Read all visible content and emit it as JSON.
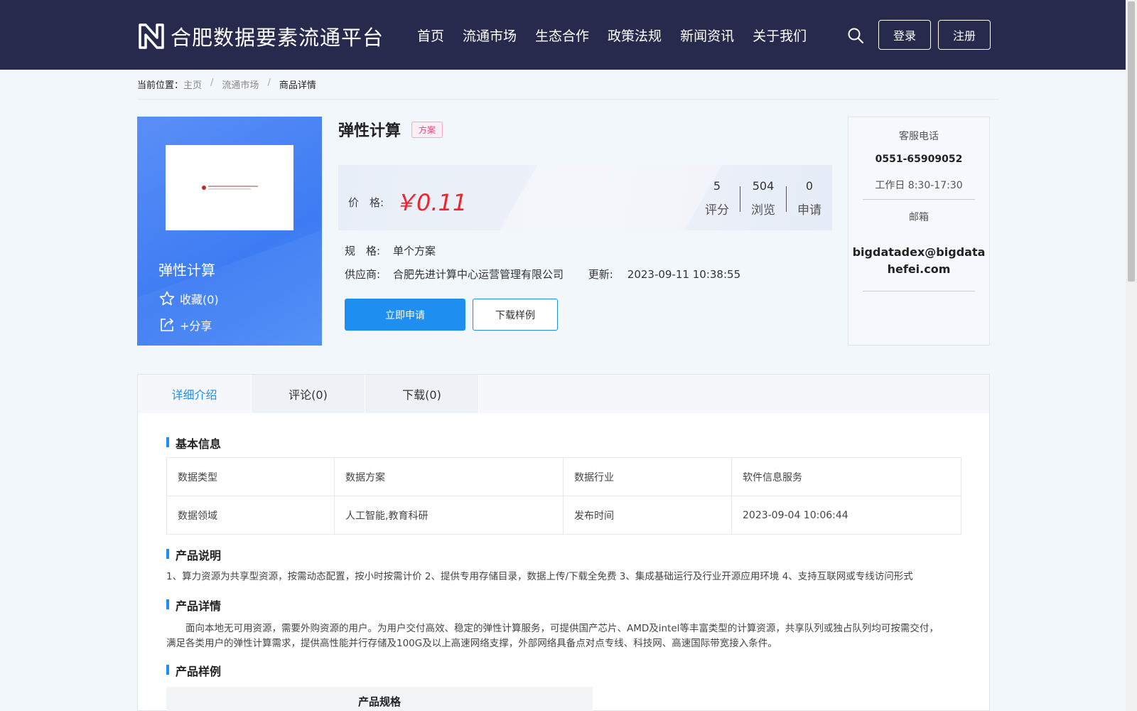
{
  "header": {
    "logo_text": "合肥数据要素流通平台",
    "nav": [
      "首页",
      "流通市场",
      "生态合作",
      "政策法规",
      "新闻资讯",
      "关于我们"
    ],
    "login": "登录",
    "register": "注册"
  },
  "breadcrumb": {
    "prefix": "当前位置：",
    "items": [
      "主页",
      "流通市场",
      "商品详情"
    ]
  },
  "product": {
    "card_name": "弹性计算",
    "favorite": "收藏(0)",
    "share": "+分享",
    "title": "弹性计算",
    "tag": "方案",
    "price_label": "价　格:",
    "price": "￥0.11",
    "stats": [
      {
        "num": "5",
        "label": "评分"
      },
      {
        "num": "504",
        "label": "浏览"
      },
      {
        "num": "0",
        "label": "申请"
      }
    ],
    "spec_label": "规　格:",
    "spec": "单个方案",
    "supplier_label": "供应商:",
    "supplier": "合肥先进计算中心运营管理有限公司",
    "updated_label": "更新:",
    "updated": "2023-09-11 10:38:55",
    "apply": "立即申请",
    "download_sample": "下载样例"
  },
  "service": {
    "phone_title": "客服电话",
    "phone": "0551-65909052",
    "hours": "工作日 8:30-17:30",
    "email_title": "邮箱",
    "email_line1": "bigdatadex@bigdata",
    "email_line2": "hefei.com"
  },
  "tabs": [
    "详细介绍",
    "评论(0)",
    "下载(0)"
  ],
  "detail": {
    "basic_title": "基本信息",
    "basic_rows": [
      [
        "数据类型",
        "数据方案",
        "数据行业",
        "软件信息服务"
      ],
      [
        "数据领域",
        "人工智能,教育科研",
        "发布时间",
        "2023-09-04 10:06:44"
      ]
    ],
    "desc_title": "产品说明",
    "desc": "1、算力资源为共享型资源，按需动态配置，按小时按需计价 2、提供专用存储目录，数据上传/下载全免费 3、集成基础运行及行业开源应用环境 4、支持互联网或专线访问形式",
    "detail_title": "产品详情",
    "detail_text": "　　面向本地无可用资源，需要外购资源的用户。为用户交付高效、稳定的弹性计算服务，可提供国产芯片、AMD及intel等丰富类型的计算资源，共享队列或独占队列均可按需交付，满足各类用户的弹性计算需求，提供高性能并行存储及100G及以上高速网络支撑，外部网络具备点对点专线、科技网、高速国际带宽接入条件。",
    "sample_title": "产品样例",
    "sample_table_header": "产品规格"
  }
}
